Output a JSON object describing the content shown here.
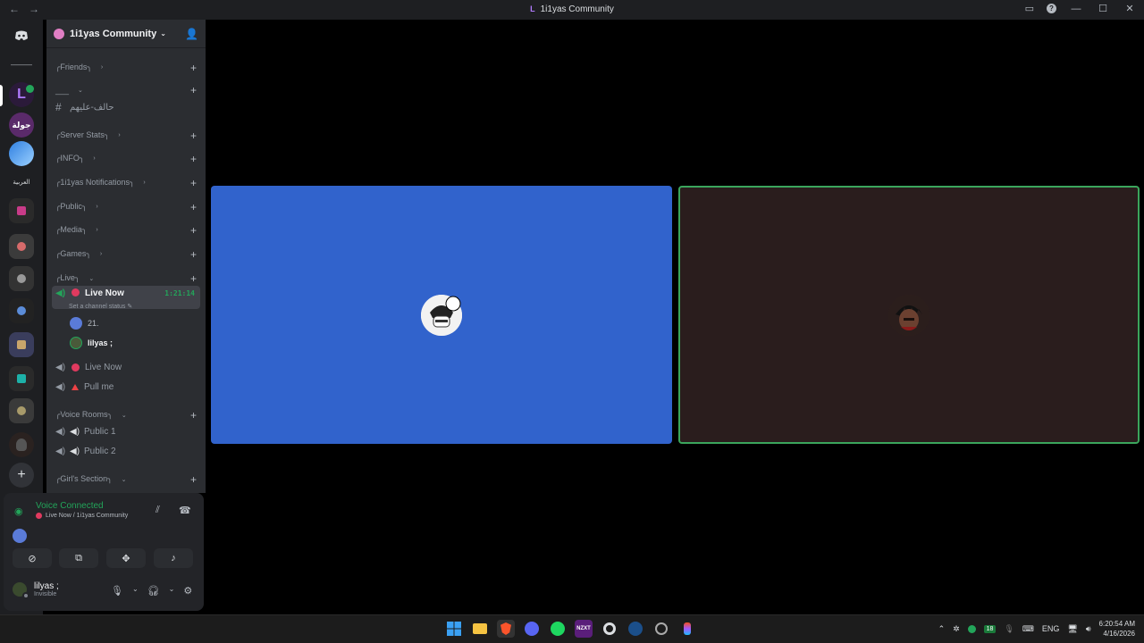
{
  "window": {
    "title": "1i1yas Community",
    "back": "←",
    "forward": "→",
    "inbox_icon": "inbox-icon",
    "help_icon": "help-icon",
    "minimize": "—",
    "maximize": "☐",
    "close": "✕"
  },
  "server": {
    "name": "1i1yas Community",
    "invite_icon": "add-person-icon"
  },
  "guild_labels": {
    "dashes": "———",
    "g3": "جولة",
    "g5": "العربية"
  },
  "categories": [
    {
      "label": "╭Friends╮"
    },
    {
      "label": "___"
    },
    {
      "label": "╭Server Stats╮"
    },
    {
      "label": "╭INFO╮"
    },
    {
      "label": "╭1i1yas Notifications╮"
    },
    {
      "label": "╭Public╮"
    },
    {
      "label": "╭Media╮"
    },
    {
      "label": "╭Games╮"
    },
    {
      "label": "╭Live╮"
    },
    {
      "label": "╭Voice Rooms╮"
    },
    {
      "label": "╭Girl's Section╮"
    }
  ],
  "channels": {
    "arabic_text": "حالف-عليهم",
    "live_now": "Live Now",
    "live_timer": "1:21:14",
    "channel_status": "Set a channel status",
    "member1": "21.",
    "member2": "lilyas ;",
    "live_now_2": "Live Now",
    "pull_me": "Pull me",
    "public1": "Public 1",
    "public2": "Public 2"
  },
  "voice": {
    "title": "Voice Connected",
    "subtitle": "Live Now / 1i1yas Community"
  },
  "user": {
    "name": "lilyas ;",
    "status": "Invisible"
  },
  "taskbar": {
    "language": "ENG",
    "time": "6:20:54 AM",
    "date": "4/16/2026",
    "badge": "18"
  },
  "colors": {
    "accent_green": "#23a55a",
    "tile1_bg": "#3163cc",
    "tile2_bg": "#2a1d1d",
    "discord_blurple": "#5865f2"
  }
}
